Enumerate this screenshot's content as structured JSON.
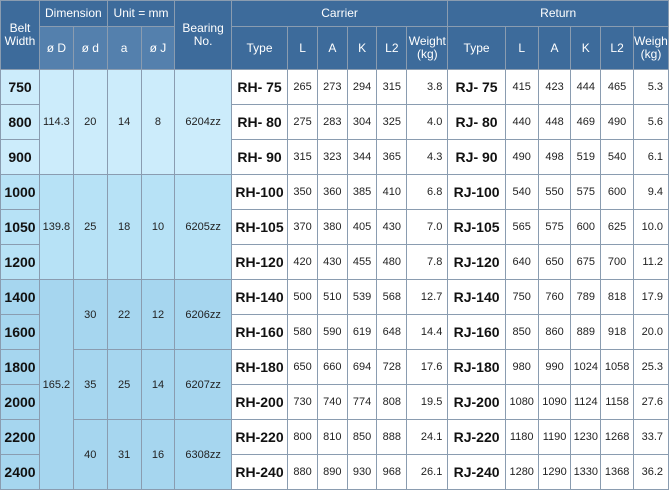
{
  "header": {
    "belt_width": "Belt\nWidth",
    "dimension": "Dimension",
    "unit": "Unit = mm",
    "bearing": "Bearing\nNo.",
    "carrier": "Carrier",
    "return": "Return",
    "phi_d_big": "ø D",
    "phi_d_small": "ø d",
    "a": "a",
    "phi_j": "ø J",
    "type": "Type",
    "L": "L",
    "A": "A",
    "K": "K",
    "L2": "L2",
    "weight": "Weight\n(kg)"
  },
  "groups": [
    {
      "D": "114.3",
      "d": "20",
      "a": "14",
      "J": "8",
      "bearing": "6204zz"
    },
    {
      "D": "139.8",
      "d": "25",
      "a": "18",
      "J": "10",
      "bearing": "6205zz"
    },
    {
      "D": "165.2"
    }
  ],
  "subgroups": [
    {
      "d": "30",
      "a": "22",
      "J": "12",
      "bearing": "6206zz"
    },
    {
      "d": "35",
      "a": "25",
      "J": "14",
      "bearing": "6207zz"
    },
    {
      "d": "40",
      "a": "31",
      "J": "16",
      "bearing": "6308zz"
    }
  ],
  "rows": [
    {
      "belt": "750",
      "ctype": "RH-  75",
      "cL": "265",
      "cA": "273",
      "cK": "294",
      "cL2": "315",
      "cW": "3.8",
      "rtype": "RJ-  75",
      "rL": "415",
      "rA": "423",
      "rK": "444",
      "rL2": "465",
      "rW": "5.3"
    },
    {
      "belt": "800",
      "ctype": "RH-  80",
      "cL": "275",
      "cA": "283",
      "cK": "304",
      "cL2": "325",
      "cW": "4.0",
      "rtype": "RJ-  80",
      "rL": "440",
      "rA": "448",
      "rK": "469",
      "rL2": "490",
      "rW": "5.6"
    },
    {
      "belt": "900",
      "ctype": "RH-  90",
      "cL": "315",
      "cA": "323",
      "cK": "344",
      "cL2": "365",
      "cW": "4.3",
      "rtype": "RJ-  90",
      "rL": "490",
      "rA": "498",
      "rK": "519",
      "rL2": "540",
      "rW": "6.1"
    },
    {
      "belt": "1000",
      "ctype": "RH-100",
      "cL": "350",
      "cA": "360",
      "cK": "385",
      "cL2": "410",
      "cW": "6.8",
      "rtype": "RJ-100",
      "rL": "540",
      "rA": "550",
      "rK": "575",
      "rL2": "600",
      "rW": "9.4"
    },
    {
      "belt": "1050",
      "ctype": "RH-105",
      "cL": "370",
      "cA": "380",
      "cK": "405",
      "cL2": "430",
      "cW": "7.0",
      "rtype": "RJ-105",
      "rL": "565",
      "rA": "575",
      "rK": "600",
      "rL2": "625",
      "rW": "10.0"
    },
    {
      "belt": "1200",
      "ctype": "RH-120",
      "cL": "420",
      "cA": "430",
      "cK": "455",
      "cL2": "480",
      "cW": "7.8",
      "rtype": "RJ-120",
      "rL": "640",
      "rA": "650",
      "rK": "675",
      "rL2": "700",
      "rW": "11.2"
    },
    {
      "belt": "1400",
      "ctype": "RH-140",
      "cL": "500",
      "cA": "510",
      "cK": "539",
      "cL2": "568",
      "cW": "12.7",
      "rtype": "RJ-140",
      "rL": "750",
      "rA": "760",
      "rK": "789",
      "rL2": "818",
      "rW": "17.9"
    },
    {
      "belt": "1600",
      "ctype": "RH-160",
      "cL": "580",
      "cA": "590",
      "cK": "619",
      "cL2": "648",
      "cW": "14.4",
      "rtype": "RJ-160",
      "rL": "850",
      "rA": "860",
      "rK": "889",
      "rL2": "918",
      "rW": "20.0"
    },
    {
      "belt": "1800",
      "ctype": "RH-180",
      "cL": "650",
      "cA": "660",
      "cK": "694",
      "cL2": "728",
      "cW": "17.6",
      "rtype": "RJ-180",
      "rL": "980",
      "rA": "990",
      "rK": "1024",
      "rL2": "1058",
      "rW": "25.3"
    },
    {
      "belt": "2000",
      "ctype": "RH-200",
      "cL": "730",
      "cA": "740",
      "cK": "774",
      "cL2": "808",
      "cW": "19.5",
      "rtype": "RJ-200",
      "rL": "1080",
      "rA": "1090",
      "rK": "1124",
      "rL2": "1158",
      "rW": "27.6"
    },
    {
      "belt": "2200",
      "ctype": "RH-220",
      "cL": "800",
      "cA": "810",
      "cK": "850",
      "cL2": "888",
      "cW": "24.1",
      "rtype": "RJ-220",
      "rL": "1180",
      "rA": "1190",
      "rK": "1230",
      "rL2": "1268",
      "rW": "33.7"
    },
    {
      "belt": "2400",
      "ctype": "RH-240",
      "cL": "880",
      "cA": "890",
      "cK": "930",
      "cL2": "968",
      "cW": "26.1",
      "rtype": "RJ-240",
      "rL": "1280",
      "rA": "1290",
      "rK": "1330",
      "rL2": "1368",
      "rW": "36.2"
    }
  ]
}
